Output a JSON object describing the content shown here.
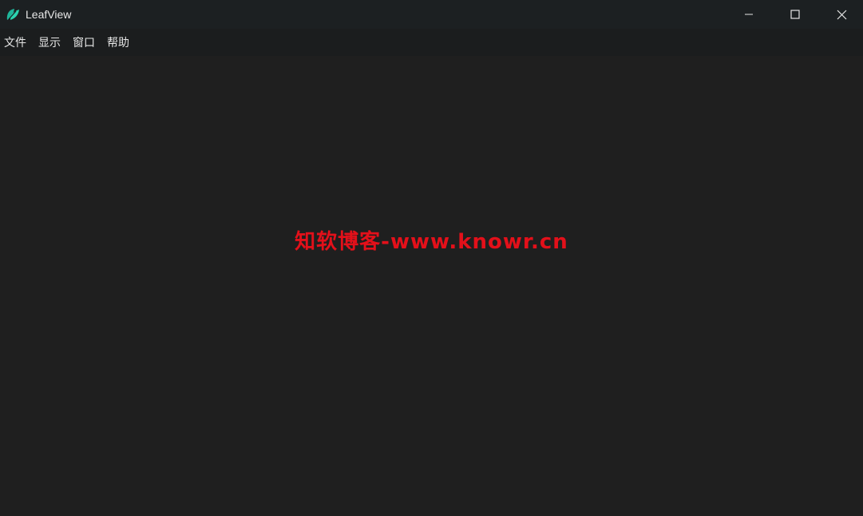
{
  "window": {
    "title": "LeafView",
    "icon": "leaf-icon",
    "controls": {
      "minimize_icon": "minimize-icon",
      "maximize_icon": "maximize-icon",
      "close_icon": "close-icon"
    }
  },
  "menu": {
    "items": [
      {
        "label": "文件"
      },
      {
        "label": "显示"
      },
      {
        "label": "窗口"
      },
      {
        "label": "帮助"
      }
    ]
  },
  "content": {
    "watermark": "知软博客-www.knowr.cn"
  },
  "colors": {
    "titlebar_bg": "#1c2022",
    "menubar_bg": "#1b1d1e",
    "content_bg": "#1f1f1f",
    "watermark": "#e3101a",
    "icon_teal": "#1fb59a"
  }
}
